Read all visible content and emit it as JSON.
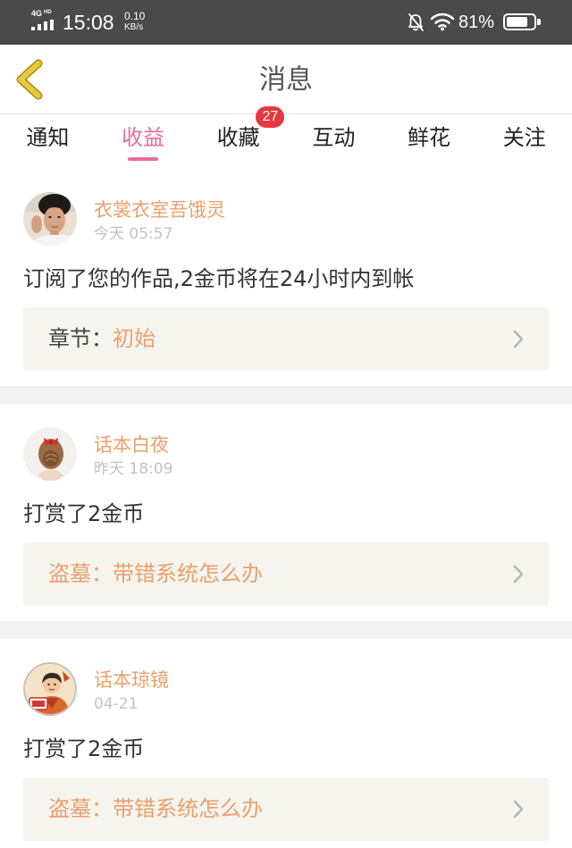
{
  "status_bar": {
    "network": "4G",
    "network_sub": "HD",
    "time": "15:08",
    "speed_value": "0.10",
    "speed_unit": "KB/s",
    "battery": "81%",
    "battery_fill": 0.81,
    "icons": [
      "signal-icon",
      "mute-bell-icon",
      "wifi-icon",
      "battery-icon"
    ]
  },
  "header": {
    "title": "消息",
    "back_icon": "chevron-left-icon"
  },
  "tabs": [
    {
      "label": "通知"
    },
    {
      "label": "收益",
      "active": true
    },
    {
      "label": "收藏",
      "badge": "27"
    },
    {
      "label": "互动"
    },
    {
      "label": "鲜花"
    },
    {
      "label": "关注"
    }
  ],
  "notifications": [
    {
      "user": "衣裳衣室吾饿灵",
      "time": "今天 05:57",
      "message": "订阅了您的作品,2金币将在24小时内到帐",
      "link_prefix": "章节：",
      "link_title": "初始",
      "link_icon": "chevron-right-icon"
    },
    {
      "user": "话本白夜",
      "time": "昨天 18:09",
      "message": "打赏了2金币",
      "link_title": "盗墓：带错系统怎么办",
      "link_icon": "chevron-right-icon"
    },
    {
      "user": "话本琼镜",
      "time": "04-21",
      "message": "打赏了2金币",
      "link_title": "盗墓：带错系统怎么办",
      "link_icon": "chevron-right-icon"
    }
  ],
  "colors": {
    "accent": "#e96c9b",
    "highlight": "#eaa06c",
    "badge": "#e5383f",
    "back_icon": "#ecc93a",
    "status_bar": "#4a4a4a"
  }
}
